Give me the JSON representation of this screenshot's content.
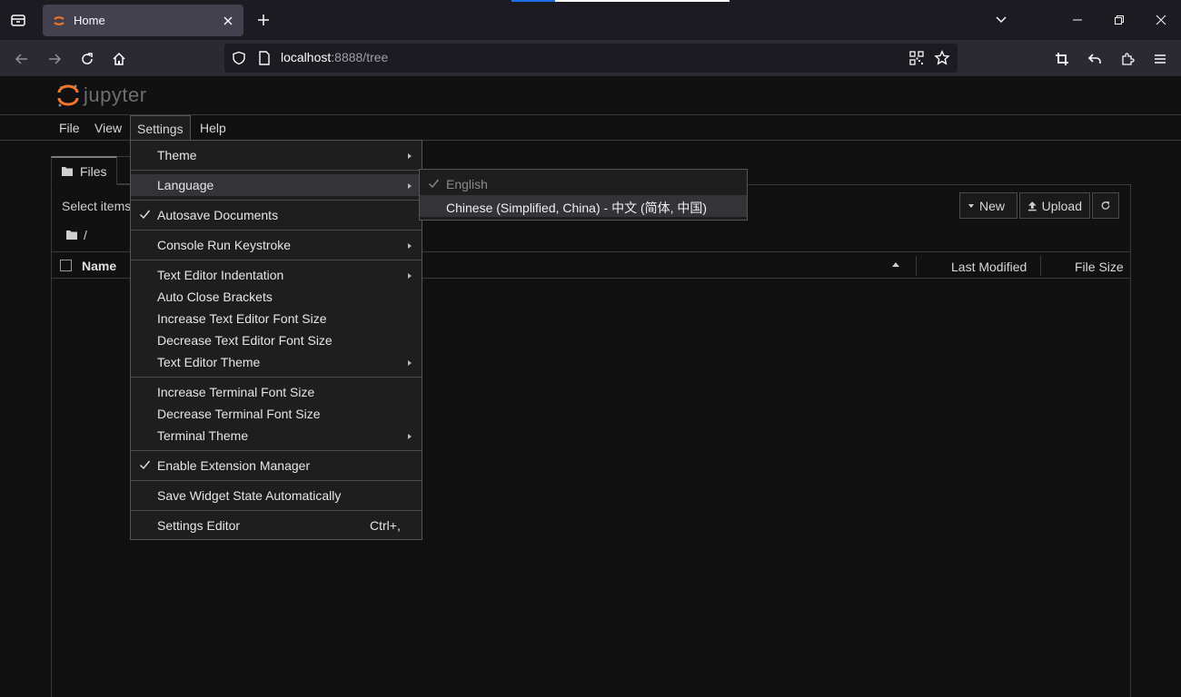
{
  "browser": {
    "tab_title": "Home",
    "url_host": "localhost",
    "url_rest": ":8888/tree"
  },
  "jupyter": {
    "logo_text": "jupyter",
    "menubar": [
      "File",
      "View",
      "Settings",
      "Help"
    ],
    "active_menu": "Settings",
    "files_tab": "Files",
    "select_items": "Select items",
    "breadcrumb": "/",
    "toolbar": {
      "new_label": "New",
      "upload_label": "Upload"
    },
    "list_header": {
      "name": "Name",
      "last_modified": "Last Modified",
      "file_size": "File Size"
    }
  },
  "settings_menu": {
    "items": [
      {
        "label": "Theme",
        "submenu": true
      },
      {
        "label": "Language",
        "submenu": true,
        "highlighted": true
      },
      {
        "label": "Autosave Documents",
        "checked": true
      },
      {
        "label": "Console Run Keystroke",
        "submenu": true
      },
      {
        "label": "Text Editor Indentation",
        "submenu": true
      },
      {
        "label": "Auto Close Brackets"
      },
      {
        "label": "Increase Text Editor Font Size"
      },
      {
        "label": "Decrease Text Editor Font Size"
      },
      {
        "label": "Text Editor Theme",
        "submenu": true
      },
      {
        "label": "Increase Terminal Font Size"
      },
      {
        "label": "Decrease Terminal Font Size"
      },
      {
        "label": "Terminal Theme",
        "submenu": true
      },
      {
        "label": "Enable Extension Manager",
        "checked": true
      },
      {
        "label": "Save Widget State Automatically"
      },
      {
        "label": "Settings Editor",
        "shortcut": "Ctrl+,"
      }
    ]
  },
  "language_submenu": {
    "items": [
      {
        "label": "English",
        "checked": true,
        "disabled": true
      },
      {
        "label": "Chinese (Simplified, China) - 中文 (简体, 中国)",
        "highlighted": true
      }
    ]
  },
  "colors": {
    "accent_orange": "#f37726",
    "background": "#111111",
    "menu_bg": "#1e1e1e"
  }
}
